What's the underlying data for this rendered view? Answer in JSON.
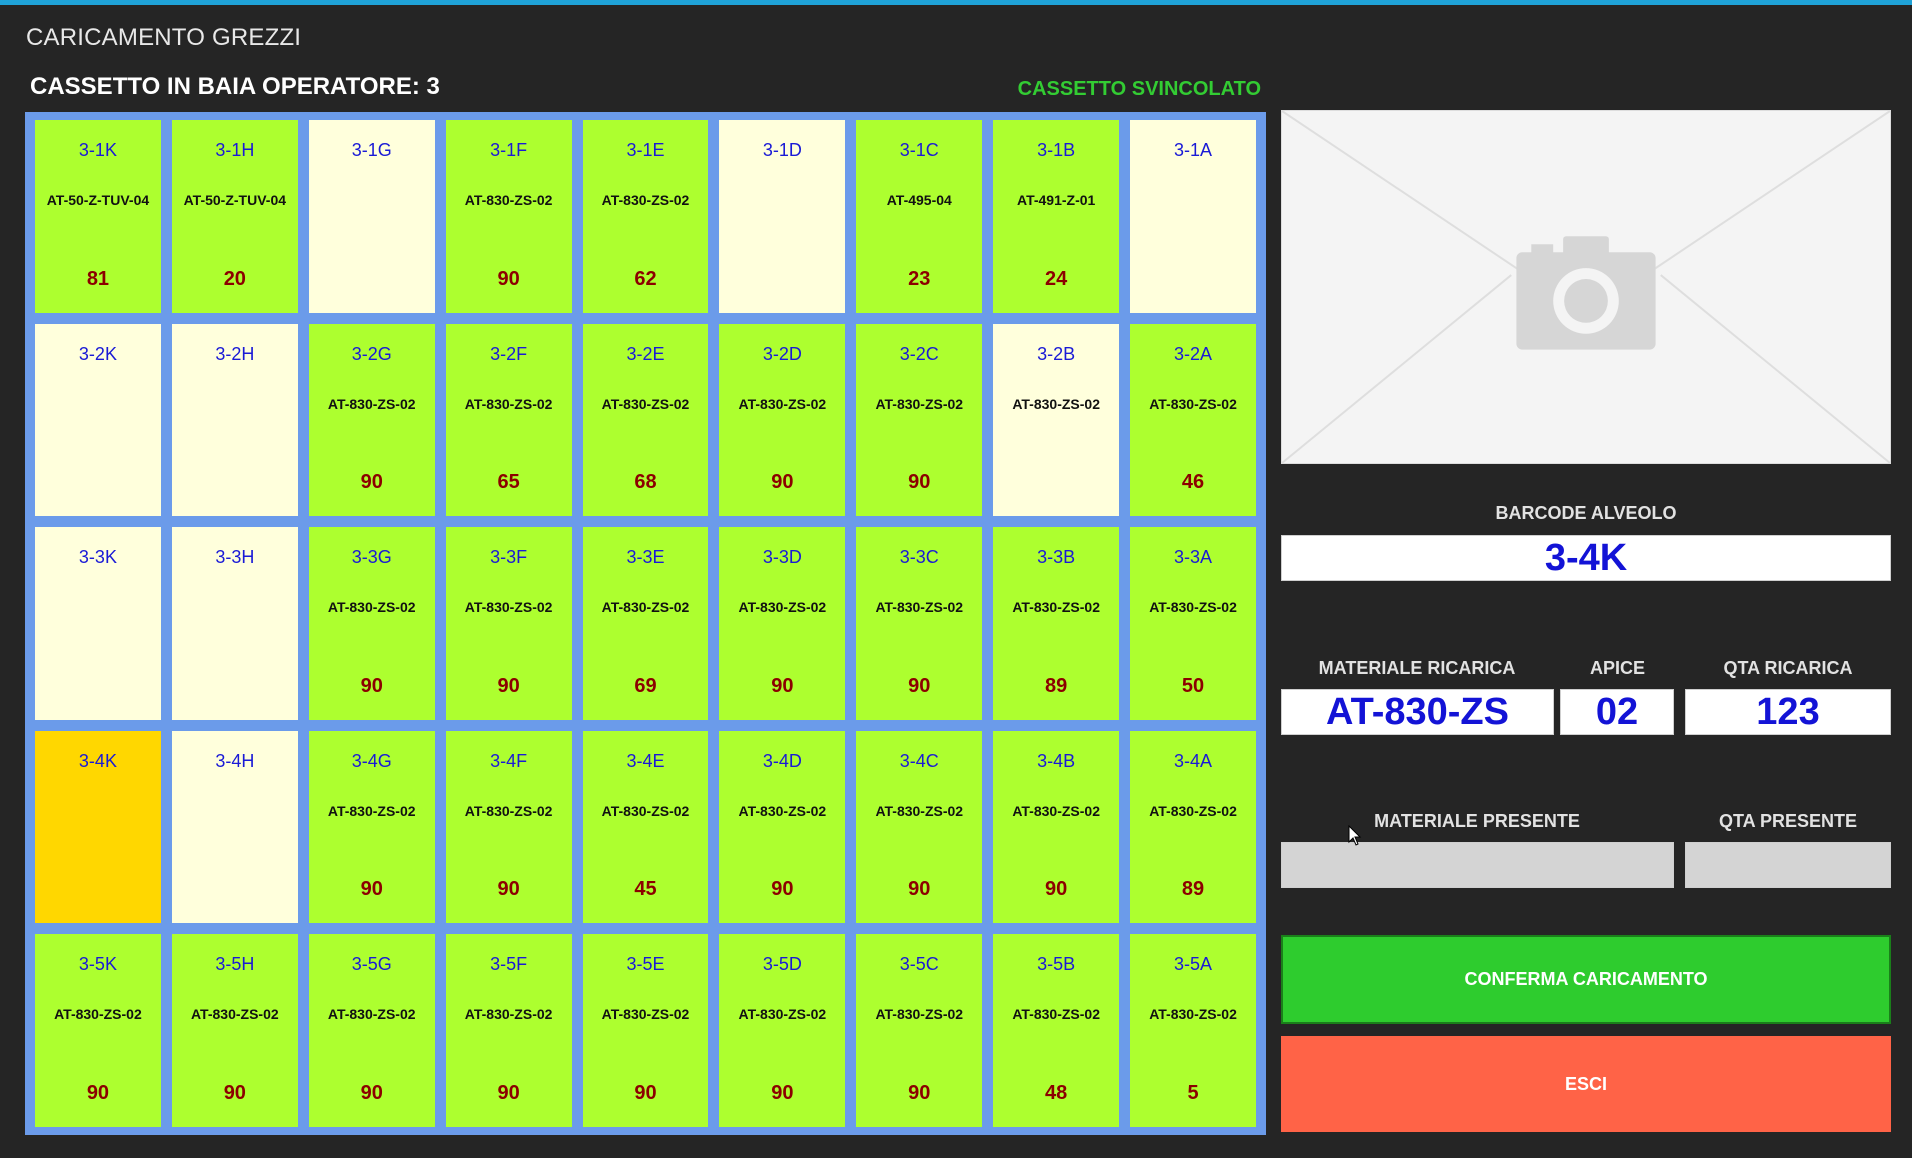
{
  "app_title": "CARICAMENTO GREZZI",
  "baia_label": "CASSETTO IN BAIA OPERATORE: 3",
  "status": "CASSETTO SVINCOLATO",
  "colors": {
    "full": "#adff2f",
    "empty": "#ffffdc",
    "selected": "#ffd700"
  },
  "grid": [
    [
      {
        "code": "3-1K",
        "material": "AT-50-Z-TUV-04",
        "qty": "81",
        "state": "full"
      },
      {
        "code": "3-1H",
        "material": "AT-50-Z-TUV-04",
        "qty": "20",
        "state": "full"
      },
      {
        "code": "3-1G",
        "material": "",
        "qty": "",
        "state": "empty"
      },
      {
        "code": "3-1F",
        "material": "AT-830-ZS-02",
        "qty": "90",
        "state": "full"
      },
      {
        "code": "3-1E",
        "material": "AT-830-ZS-02",
        "qty": "62",
        "state": "full"
      },
      {
        "code": "3-1D",
        "material": "",
        "qty": "",
        "state": "empty"
      },
      {
        "code": "3-1C",
        "material": "AT-495-04",
        "qty": "23",
        "state": "full"
      },
      {
        "code": "3-1B",
        "material": "AT-491-Z-01",
        "qty": "24",
        "state": "full"
      },
      {
        "code": "3-1A",
        "material": "",
        "qty": "",
        "state": "empty"
      }
    ],
    [
      {
        "code": "3-2K",
        "material": "",
        "qty": "",
        "state": "empty"
      },
      {
        "code": "3-2H",
        "material": "",
        "qty": "",
        "state": "empty"
      },
      {
        "code": "3-2G",
        "material": "AT-830-ZS-02",
        "qty": "90",
        "state": "full"
      },
      {
        "code": "3-2F",
        "material": "AT-830-ZS-02",
        "qty": "65",
        "state": "full"
      },
      {
        "code": "3-2E",
        "material": "AT-830-ZS-02",
        "qty": "68",
        "state": "full"
      },
      {
        "code": "3-2D",
        "material": "AT-830-ZS-02",
        "qty": "90",
        "state": "full"
      },
      {
        "code": "3-2C",
        "material": "AT-830-ZS-02",
        "qty": "90",
        "state": "full"
      },
      {
        "code": "3-2B",
        "material": "AT-830-ZS-02",
        "qty": "",
        "state": "empty"
      },
      {
        "code": "3-2A",
        "material": "AT-830-ZS-02",
        "qty": "46",
        "state": "full"
      }
    ],
    [
      {
        "code": "3-3K",
        "material": "",
        "qty": "",
        "state": "empty"
      },
      {
        "code": "3-3H",
        "material": "",
        "qty": "",
        "state": "empty"
      },
      {
        "code": "3-3G",
        "material": "AT-830-ZS-02",
        "qty": "90",
        "state": "full"
      },
      {
        "code": "3-3F",
        "material": "AT-830-ZS-02",
        "qty": "90",
        "state": "full"
      },
      {
        "code": "3-3E",
        "material": "AT-830-ZS-02",
        "qty": "69",
        "state": "full"
      },
      {
        "code": "3-3D",
        "material": "AT-830-ZS-02",
        "qty": "90",
        "state": "full"
      },
      {
        "code": "3-3C",
        "material": "AT-830-ZS-02",
        "qty": "90",
        "state": "full"
      },
      {
        "code": "3-3B",
        "material": "AT-830-ZS-02",
        "qty": "89",
        "state": "full"
      },
      {
        "code": "3-3A",
        "material": "AT-830-ZS-02",
        "qty": "50",
        "state": "full"
      }
    ],
    [
      {
        "code": "3-4K",
        "material": "",
        "qty": "",
        "state": "selected"
      },
      {
        "code": "3-4H",
        "material": "",
        "qty": "",
        "state": "empty"
      },
      {
        "code": "3-4G",
        "material": "AT-830-ZS-02",
        "qty": "90",
        "state": "full"
      },
      {
        "code": "3-4F",
        "material": "AT-830-ZS-02",
        "qty": "90",
        "state": "full"
      },
      {
        "code": "3-4E",
        "material": "AT-830-ZS-02",
        "qty": "45",
        "state": "full"
      },
      {
        "code": "3-4D",
        "material": "AT-830-ZS-02",
        "qty": "90",
        "state": "full"
      },
      {
        "code": "3-4C",
        "material": "AT-830-ZS-02",
        "qty": "90",
        "state": "full"
      },
      {
        "code": "3-4B",
        "material": "AT-830-ZS-02",
        "qty": "90",
        "state": "full"
      },
      {
        "code": "3-4A",
        "material": "AT-830-ZS-02",
        "qty": "89",
        "state": "full"
      }
    ],
    [
      {
        "code": "3-5K",
        "material": "AT-830-ZS-02",
        "qty": "90",
        "state": "full"
      },
      {
        "code": "3-5H",
        "material": "AT-830-ZS-02",
        "qty": "90",
        "state": "full"
      },
      {
        "code": "3-5G",
        "material": "AT-830-ZS-02",
        "qty": "90",
        "state": "full"
      },
      {
        "code": "3-5F",
        "material": "AT-830-ZS-02",
        "qty": "90",
        "state": "full"
      },
      {
        "code": "3-5E",
        "material": "AT-830-ZS-02",
        "qty": "90",
        "state": "full"
      },
      {
        "code": "3-5D",
        "material": "AT-830-ZS-02",
        "qty": "90",
        "state": "full"
      },
      {
        "code": "3-5C",
        "material": "AT-830-ZS-02",
        "qty": "90",
        "state": "full"
      },
      {
        "code": "3-5B",
        "material": "AT-830-ZS-02",
        "qty": "48",
        "state": "full"
      },
      {
        "code": "3-5A",
        "material": "AT-830-ZS-02",
        "qty": "5",
        "state": "full"
      }
    ]
  ],
  "photo": {
    "icon": "camera-icon"
  },
  "barcode": {
    "label": "BARCODE ALVEOLO",
    "value": "3-4K"
  },
  "ricarica": {
    "material_label": "MATERIALE RICARICA",
    "material_value": "AT-830-ZS",
    "apice_label": "APICE",
    "apice_value": "02",
    "qty_label": "QTA RICARICA",
    "qty_value": "123"
  },
  "presente": {
    "material_label": "MATERIALE PRESENTE",
    "material_value": "",
    "qty_label": "QTA PRESENTE",
    "qty_value": ""
  },
  "buttons": {
    "confirm": "CONFERMA CARICAMENTO",
    "exit": "ESCI"
  }
}
